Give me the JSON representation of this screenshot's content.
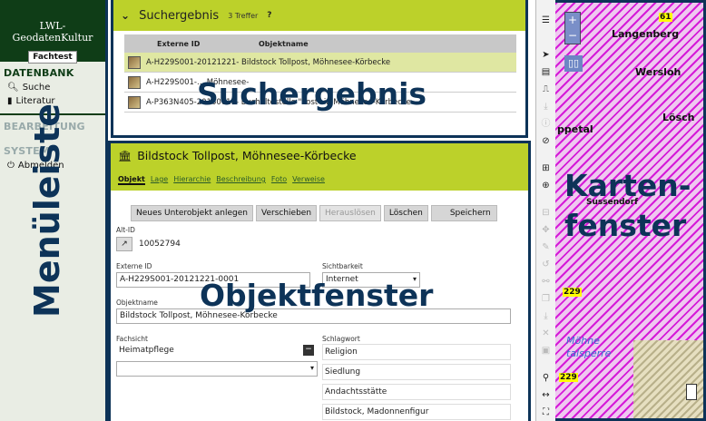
{
  "menu": {
    "logo_line1": "LWL-GeodatenKultur",
    "logo_badge": "Fachtest",
    "datenbank_head": "DATENBANK",
    "item_suche": "Suche",
    "item_literatur": "Literatur",
    "bearbeitung_head": "BEARBEITUNG",
    "system_head": "SYSTEM",
    "item_abmelden": "Abmelden",
    "overlay": "Menüleiste"
  },
  "search": {
    "title": "Suchergebnis",
    "count": "3 Treffer",
    "col_id": "Externe ID",
    "col_name": "Objektname",
    "rows": [
      {
        "text": "A-H229S001-20121221- Bildstock Tollpost, Möhnesee-Körbecke"
      },
      {
        "text": "A-H229S001-... Möhnesee-"
      },
      {
        "text": "A-P363N405-20160610- Bushaltestelle \"Post\" in Möhnesee-Körbecke"
      }
    ],
    "overlay": "Suchergebnis"
  },
  "object": {
    "title": "Bildstock Tollpost, Möhnesee-Körbecke",
    "tabs": [
      "Objekt",
      "Lage",
      "Hierarchie",
      "Beschreibung",
      "Foto",
      "Verweise"
    ],
    "buttons": {
      "new_sub": "Neues Unterobjekt anlegen",
      "move": "Verschieben",
      "release": "Herauslösen",
      "delete": "Löschen",
      "save": "Speichern"
    },
    "alt_id_label": "Alt-ID",
    "alt_id_value": "10052794",
    "ext_id_label": "Externe ID",
    "ext_id_value": "A-H229S001-20121221-0001",
    "visibility_label": "Sichtbarkeit",
    "visibility_value": "Internet",
    "name_label": "Objektname",
    "name_value": "Bildstock Tollpost, Möhnesee-Körbecke",
    "fachsicht_label": "Fachsicht",
    "fachsicht_value": "Heimatpflege",
    "schlagwort_label": "Schlagwort",
    "schlagworte": [
      "Religion",
      "Siedlung",
      "Andachtsstätte",
      "Bildstock, Madonnenfigur"
    ],
    "overlay": "Objektfenster"
  },
  "map": {
    "labels": [
      "61",
      "Langenberg",
      "Wersloh",
      "Lösch",
      "ppetal",
      "Sussendorf",
      "229",
      "Möhne",
      "talsperre",
      "229"
    ],
    "overlay_line1": "Karten-",
    "overlay_line2": "fenster"
  }
}
